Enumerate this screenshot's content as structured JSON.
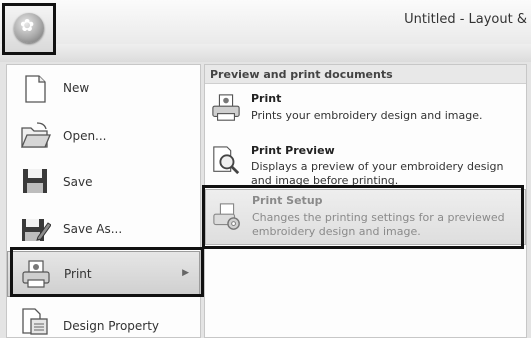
{
  "window": {
    "title": "Untitled - Layout &"
  },
  "app_button": {
    "icon": "app-orb-icon"
  },
  "file_menu": {
    "items": [
      {
        "label": "New",
        "icon": "new-document-icon"
      },
      {
        "label": "Open...",
        "icon": "open-folder-icon"
      },
      {
        "label": "Save",
        "icon": "save-icon"
      },
      {
        "label": "Save As...",
        "icon": "save-as-icon"
      },
      {
        "label": "Print",
        "icon": "print-icon"
      },
      {
        "label": "Design Property",
        "icon": "design-property-icon"
      }
    ]
  },
  "submenu": {
    "heading": "Preview and print documents",
    "items": [
      {
        "title": "Print",
        "description": "Prints your embroidery design and image."
      },
      {
        "title": "Print Preview",
        "description": "Displays a preview of your embroidery design and image before printing."
      },
      {
        "title": "Print Setup",
        "description": "Changes the printing settings for a previewed embroidery design and image."
      }
    ]
  },
  "colors": {
    "highlight_frame": "#111111",
    "pane_bg": "#fdfdfd",
    "menu_bg": "#e4e4e4"
  }
}
